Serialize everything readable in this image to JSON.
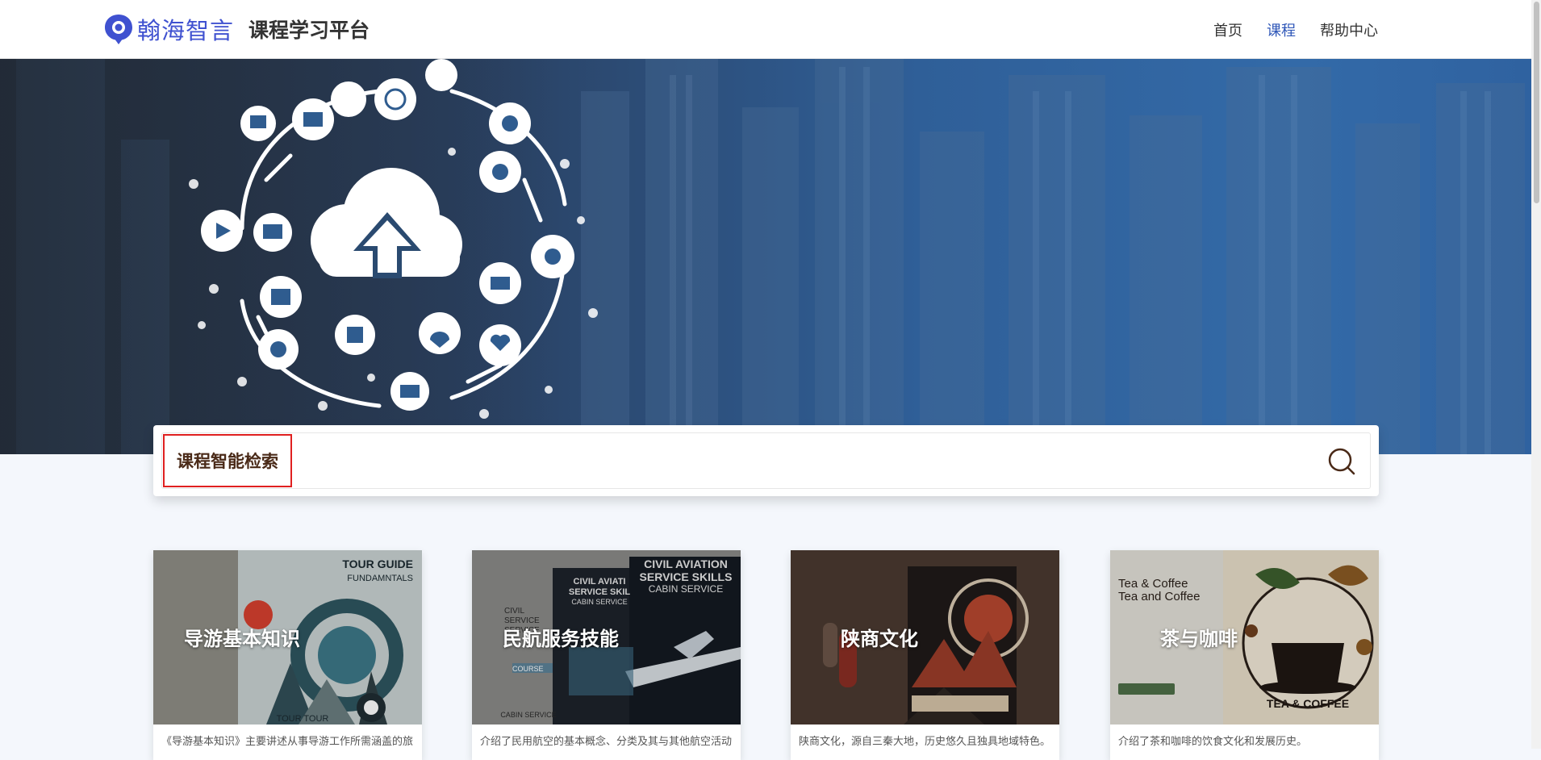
{
  "header": {
    "brand": "翰海智言",
    "platform": "课程学习平台",
    "nav": [
      {
        "label": "首页",
        "active": false
      },
      {
        "label": "课程",
        "active": true
      },
      {
        "label": "帮助中心",
        "active": false
      }
    ]
  },
  "search": {
    "label": "课程智能检索",
    "placeholder": "",
    "button_icon": "search-icon"
  },
  "courses": [
    {
      "title": "导游基本知识",
      "description": "《导游基本知识》主要讲述从事导游工作所需涵盖的旅",
      "cover_text": [
        "TOUR GUIDE",
        "FUNDAMNTALS",
        "TOUR TOUR"
      ]
    },
    {
      "title": "民航服务技能",
      "description": "介绍了民用航空的基本概念、分类及其与其他航空活动",
      "cover_text": [
        "CIVIL AVIATION",
        "SERVICE SKILLS",
        "CABIN SERVICE",
        "CIVIL AVIATI",
        "SERVICE SKIL",
        "CABIN SERVICE",
        "CIVIL",
        "SERVICE",
        "SERVICE",
        "COURSE",
        "CABIN SERVICE"
      ]
    },
    {
      "title": "陕商文化",
      "description": "陕商文化，源自三秦大地，历史悠久且独具地域特色。",
      "cover_text": []
    },
    {
      "title": "茶与咖啡",
      "description": "介绍了茶和咖啡的饮食文化和发展历史。",
      "cover_text": [
        "Tea & Coffee",
        "Tea and Coffee",
        "TEA & COFFEE"
      ]
    }
  ],
  "colors": {
    "brand": "#3f51d0",
    "nav_active": "#2f57b8",
    "search_label_border": "#e02020"
  }
}
